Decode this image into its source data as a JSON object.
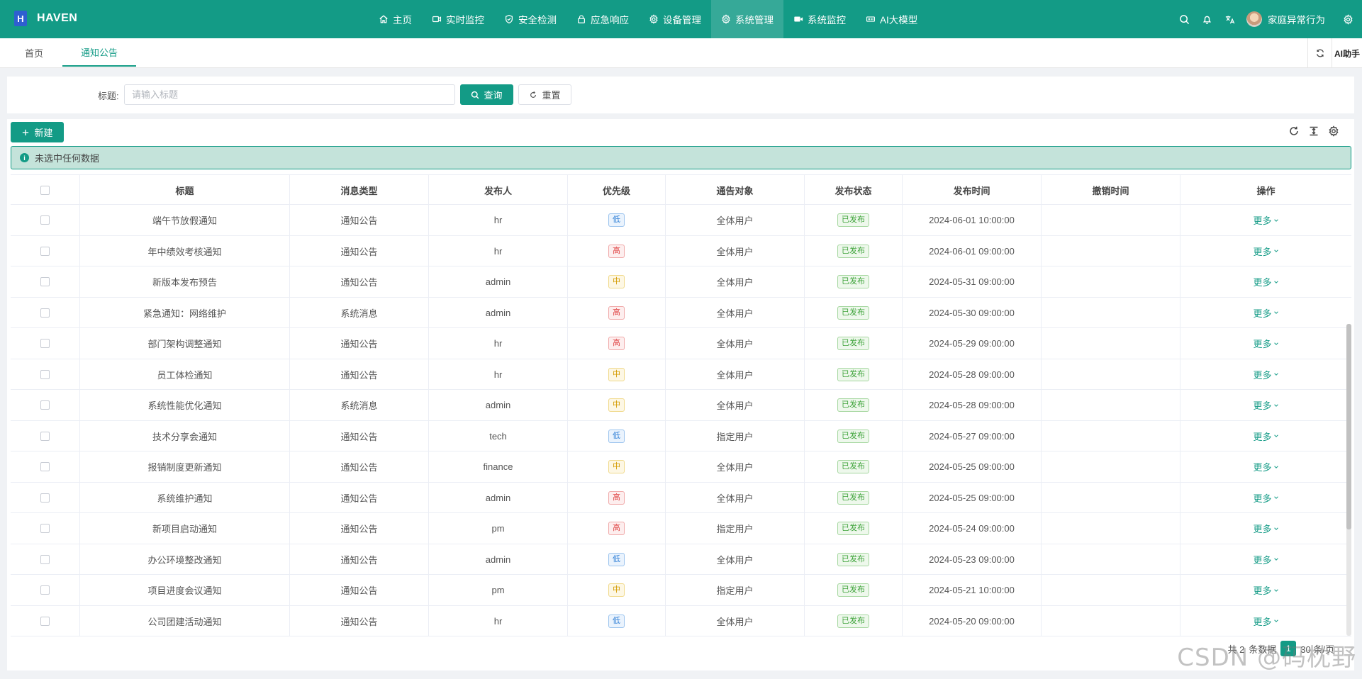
{
  "brand": {
    "logo_letter": "H",
    "name": "HAVEN",
    "accent_color": "#139b86"
  },
  "nav": [
    {
      "label": "主页",
      "icon": "home-icon",
      "active": false
    },
    {
      "label": "实时监控",
      "icon": "camera-icon",
      "active": false
    },
    {
      "label": "安全检测",
      "icon": "shield-icon",
      "active": false
    },
    {
      "label": "应急响应",
      "icon": "lock-icon",
      "active": false
    },
    {
      "label": "设备管理",
      "icon": "gear-icon",
      "active": false
    },
    {
      "label": "系统管理",
      "icon": "gear-icon",
      "active": true
    },
    {
      "label": "系统监控",
      "icon": "video-icon",
      "active": false
    },
    {
      "label": "AI大模型",
      "icon": "radio-icon",
      "active": false
    }
  ],
  "header_tools": {
    "user_name": "家庭异常行为"
  },
  "tabs": [
    {
      "label": "首页",
      "active": false
    },
    {
      "label": "通知公告",
      "active": true
    }
  ],
  "tabs_right": {
    "ai_label": "AI助手"
  },
  "search": {
    "title_label": "标题:",
    "title_placeholder": "请输入标题",
    "query_label": "查询",
    "reset_label": "重置"
  },
  "toolbar": {
    "new_label": "新建"
  },
  "alert": {
    "text": "未选中任何数据"
  },
  "table": {
    "columns": [
      "标题",
      "消息类型",
      "发布人",
      "优先级",
      "通告对象",
      "发布状态",
      "发布时间",
      "撤销时间",
      "操作"
    ],
    "rows": [
      {
        "title": "端午节放假通知",
        "type": "通知公告",
        "publisher": "hr",
        "priority": "低",
        "target": "全体用户",
        "status": "已发布",
        "publish_time": "2024-06-01 10:00:00",
        "revoke_time": "",
        "action": "更多"
      },
      {
        "title": "年中绩效考核通知",
        "type": "通知公告",
        "publisher": "hr",
        "priority": "高",
        "target": "全体用户",
        "status": "已发布",
        "publish_time": "2024-06-01 09:00:00",
        "revoke_time": "",
        "action": "更多"
      },
      {
        "title": "新版本发布预告",
        "type": "通知公告",
        "publisher": "admin",
        "priority": "中",
        "target": "全体用户",
        "status": "已发布",
        "publish_time": "2024-05-31 09:00:00",
        "revoke_time": "",
        "action": "更多"
      },
      {
        "title": "紧急通知：网络维护",
        "type": "系统消息",
        "publisher": "admin",
        "priority": "高",
        "target": "全体用户",
        "status": "已发布",
        "publish_time": "2024-05-30 09:00:00",
        "revoke_time": "",
        "action": "更多"
      },
      {
        "title": "部门架构调整通知",
        "type": "通知公告",
        "publisher": "hr",
        "priority": "高",
        "target": "全体用户",
        "status": "已发布",
        "publish_time": "2024-05-29 09:00:00",
        "revoke_time": "",
        "action": "更多"
      },
      {
        "title": "员工体检通知",
        "type": "通知公告",
        "publisher": "hr",
        "priority": "中",
        "target": "全体用户",
        "status": "已发布",
        "publish_time": "2024-05-28 09:00:00",
        "revoke_time": "",
        "action": "更多"
      },
      {
        "title": "系统性能优化通知",
        "type": "系统消息",
        "publisher": "admin",
        "priority": "中",
        "target": "全体用户",
        "status": "已发布",
        "publish_time": "2024-05-28 09:00:00",
        "revoke_time": "",
        "action": "更多"
      },
      {
        "title": "技术分享会通知",
        "type": "通知公告",
        "publisher": "tech",
        "priority": "低",
        "target": "指定用户",
        "status": "已发布",
        "publish_time": "2024-05-27 09:00:00",
        "revoke_time": "",
        "action": "更多"
      },
      {
        "title": "报销制度更新通知",
        "type": "通知公告",
        "publisher": "finance",
        "priority": "中",
        "target": "全体用户",
        "status": "已发布",
        "publish_time": "2024-05-25 09:00:00",
        "revoke_time": "",
        "action": "更多"
      },
      {
        "title": "系统维护通知",
        "type": "通知公告",
        "publisher": "admin",
        "priority": "高",
        "target": "全体用户",
        "status": "已发布",
        "publish_time": "2024-05-25 09:00:00",
        "revoke_time": "",
        "action": "更多"
      },
      {
        "title": "新项目启动通知",
        "type": "通知公告",
        "publisher": "pm",
        "priority": "高",
        "target": "指定用户",
        "status": "已发布",
        "publish_time": "2024-05-24 09:00:00",
        "revoke_time": "",
        "action": "更多"
      },
      {
        "title": "办公环境整改通知",
        "type": "通知公告",
        "publisher": "admin",
        "priority": "低",
        "target": "全体用户",
        "status": "已发布",
        "publish_time": "2024-05-23 09:00:00",
        "revoke_time": "",
        "action": "更多"
      },
      {
        "title": "项目进度会议通知",
        "type": "通知公告",
        "publisher": "pm",
        "priority": "中",
        "target": "指定用户",
        "status": "已发布",
        "publish_time": "2024-05-21 10:00:00",
        "revoke_time": "",
        "action": "更多"
      },
      {
        "title": "公司团建活动通知",
        "type": "通知公告",
        "publisher": "hr",
        "priority": "低",
        "target": "全体用户",
        "status": "已发布",
        "publish_time": "2024-05-20 09:00:00",
        "revoke_time": "",
        "action": "更多"
      }
    ]
  },
  "pagination": {
    "total_prefix": "共 2",
    "total_suffix": "条数据",
    "current_page": "1",
    "page_size": "30 条/页"
  },
  "watermark": "CSDN @码枕野"
}
